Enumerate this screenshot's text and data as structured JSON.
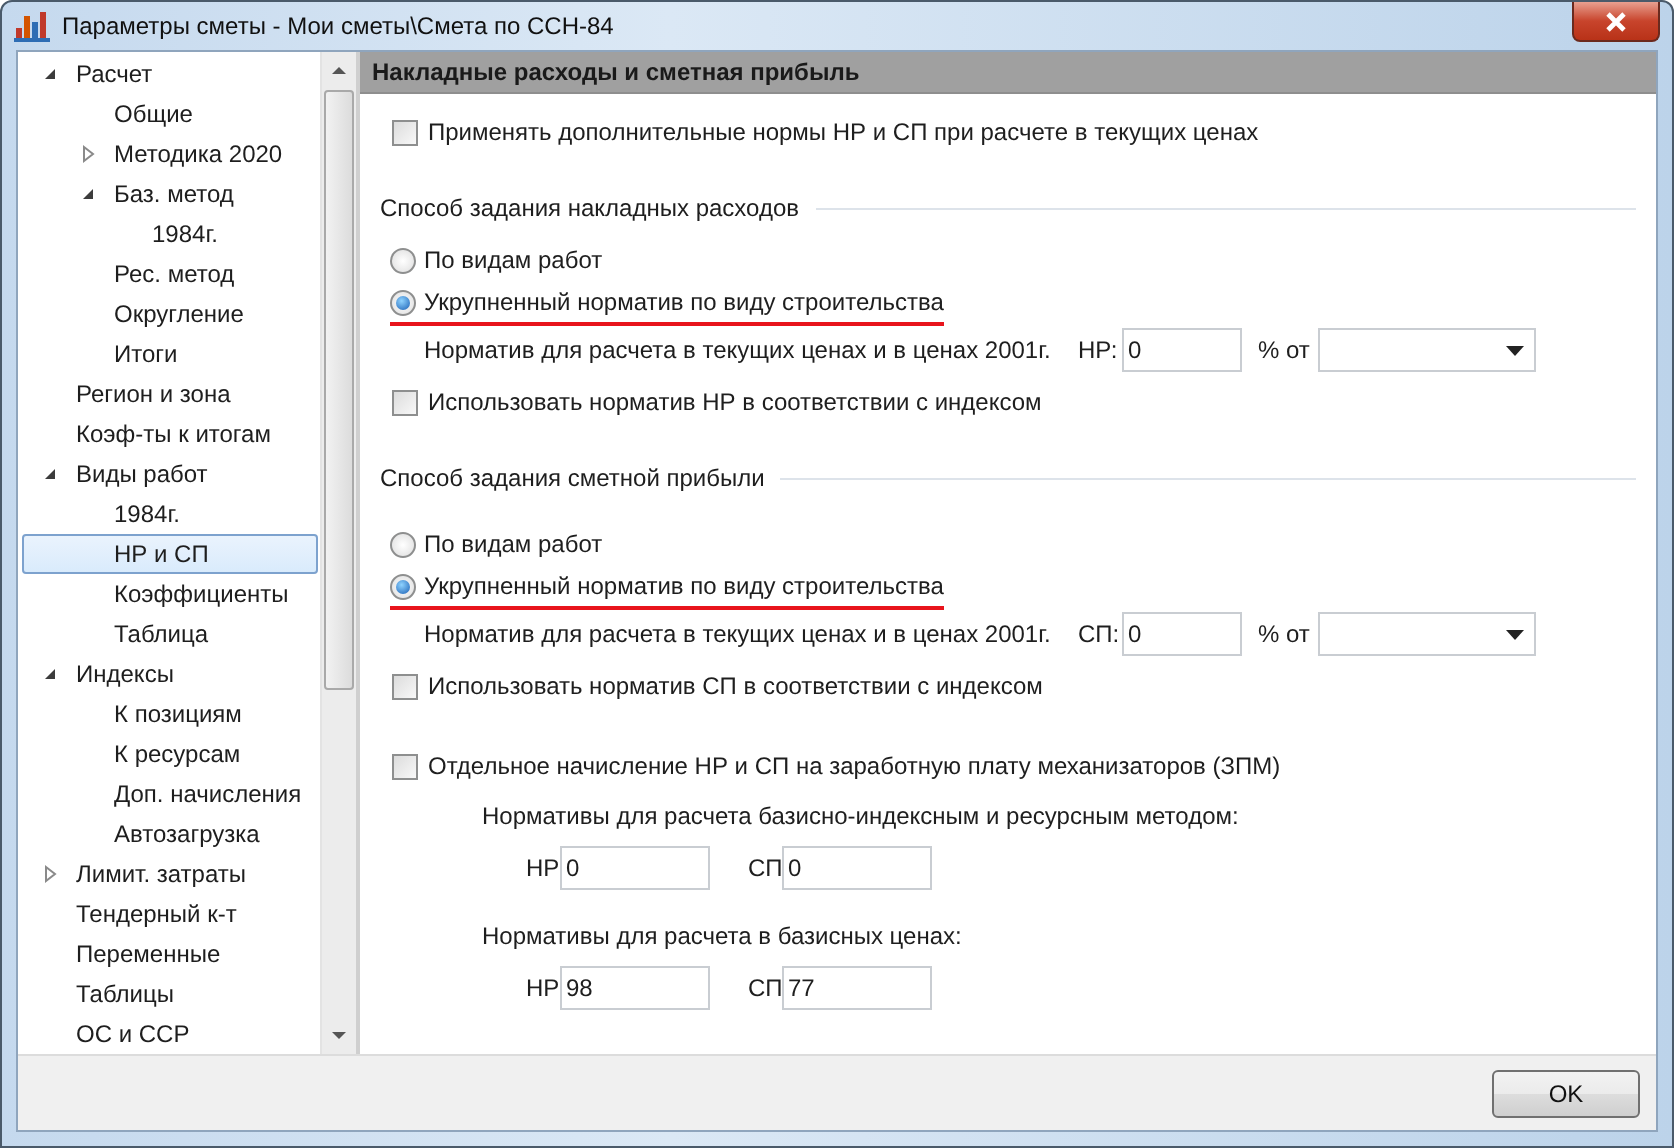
{
  "window": {
    "title": "Параметры сметы - Мои сметы\\Смета по ССН-84"
  },
  "sidebar": {
    "items": [
      {
        "label": "Расчет",
        "selected": false,
        "expanded": true,
        "children": [
          {
            "label": "Общие",
            "selected": false
          },
          {
            "label": "Методика 2020",
            "selected": false,
            "expanded": false
          },
          {
            "label": "Баз. метод",
            "selected": false,
            "expanded": true,
            "children": [
              {
                "label": "1984г.",
                "selected": false
              }
            ]
          },
          {
            "label": "Рес. метод",
            "selected": false
          },
          {
            "label": "Округление",
            "selected": false
          },
          {
            "label": "Итоги",
            "selected": false
          }
        ]
      },
      {
        "label": "Регион и зона",
        "selected": false
      },
      {
        "label": "Коэф-ты к итогам",
        "selected": false
      },
      {
        "label": "Виды работ",
        "selected": false,
        "expanded": true,
        "children": [
          {
            "label": "1984г.",
            "selected": false
          },
          {
            "label": "НР и СП",
            "selected": true
          },
          {
            "label": "Коэффициенты",
            "selected": false
          },
          {
            "label": "Таблица",
            "selected": false
          }
        ]
      },
      {
        "label": "Индексы",
        "selected": false,
        "expanded": true,
        "children": [
          {
            "label": "К позициям",
            "selected": false
          },
          {
            "label": "К ресурсам",
            "selected": false
          },
          {
            "label": "Доп. начисления",
            "selected": false
          },
          {
            "label": "Автозагрузка",
            "selected": false
          }
        ]
      },
      {
        "label": "Лимит. затраты",
        "selected": false,
        "expanded": false
      },
      {
        "label": "Тендерный к-т",
        "selected": false
      },
      {
        "label": "Переменные",
        "selected": false
      },
      {
        "label": "Таблицы",
        "selected": false
      },
      {
        "label": "ОС и ССР",
        "selected": false
      }
    ]
  },
  "panel": {
    "title": "Накладные расходы и сметная прибыль",
    "apply_extra": {
      "label": "Применять дополнительные нормы НР и СП при расчете в текущих ценах",
      "checked": false
    },
    "sections": [
      {
        "title": "Способ задания накладных расходов",
        "options": [
          {
            "label": "По видам работ",
            "selected": false,
            "underlined": false
          },
          {
            "label": "Укрупненный норматив по виду строительства",
            "selected": true,
            "underlined": true
          }
        ],
        "norm_label": "Норматив для расчета в текущих ценах и в ценах 2001г.",
        "field_label": "НР:",
        "field_value": "0",
        "percent_label": "% от",
        "use_index": {
          "label": "Использовать норматив НР в соответствии с индексом",
          "checked": false
        }
      },
      {
        "title": "Способ задания сметной прибыли",
        "options": [
          {
            "label": "По видам работ",
            "selected": false,
            "underlined": false
          },
          {
            "label": "Укрупненный норматив по виду строительства",
            "selected": true,
            "underlined": true
          }
        ],
        "norm_label": "Норматив для расчета в текущих ценах и в ценах 2001г.",
        "field_label": "СП:",
        "field_value": "0",
        "percent_label": "% от",
        "use_index": {
          "label": "Использовать норматив СП в соответствии с индексом",
          "checked": false
        }
      }
    ],
    "separate": {
      "label": "Отдельное начисление НР и СП на заработную плату механизаторов (ЗПМ)",
      "checked": false
    },
    "groups": [
      {
        "title": "Нормативы для расчета базисно-индексным и ресурсным методом:",
        "fields": [
          {
            "label": "НР",
            "value": "0"
          },
          {
            "label": "СП",
            "value": "0"
          }
        ]
      },
      {
        "title": "Нормативы для расчета в базисных ценах:",
        "fields": [
          {
            "label": "НР",
            "value": "98"
          },
          {
            "label": "СП",
            "value": "77"
          }
        ]
      }
    ]
  },
  "buttons": [
    {
      "label": "OK"
    }
  ]
}
